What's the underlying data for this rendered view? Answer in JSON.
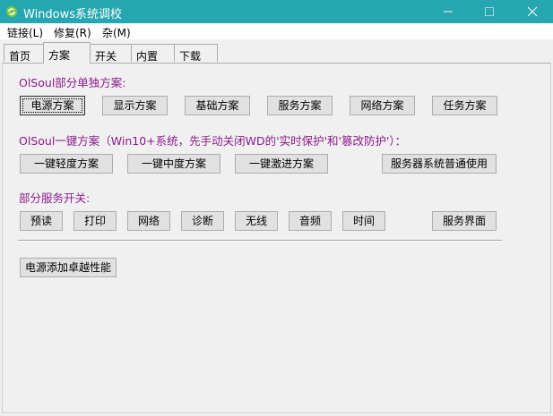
{
  "window": {
    "title": "Windows系统调校",
    "controls": {
      "minimize": "minimize-icon",
      "maximize": "maximize-icon",
      "close": "close-icon"
    }
  },
  "menu": [
    {
      "label": "链接(L)"
    },
    {
      "label": "修复(R)"
    },
    {
      "label": "杂(M)"
    }
  ],
  "tabs": [
    {
      "label": "首页"
    },
    {
      "label": "方案",
      "active": true
    },
    {
      "label": "开关"
    },
    {
      "label": "内置"
    },
    {
      "label": "下载"
    }
  ],
  "section1": {
    "heading": "OlSoul部分单独方案:",
    "buttons": [
      "电源方案",
      "显示方案",
      "基础方案",
      "服务方案",
      "网络方案",
      "任务方案"
    ]
  },
  "section2": {
    "heading": "OlSoul一键方案（Win10+系统，先手动关闭WD的'实时保护'和'篡改防护'）：",
    "buttons": [
      "一键轻度方案",
      "一键中度方案",
      "一键激进方案",
      "服务器系统普通使用"
    ]
  },
  "section3": {
    "heading": "部分服务开关:",
    "buttons": [
      "预读",
      "打印",
      "网络",
      "诊断",
      "无线",
      "音频",
      "时间",
      "服务界面"
    ]
  },
  "extra": {
    "power_button": "电源添加卓越性能"
  },
  "colors": {
    "titlebar": "#26a6b0",
    "heading": "#8b1a8b"
  }
}
